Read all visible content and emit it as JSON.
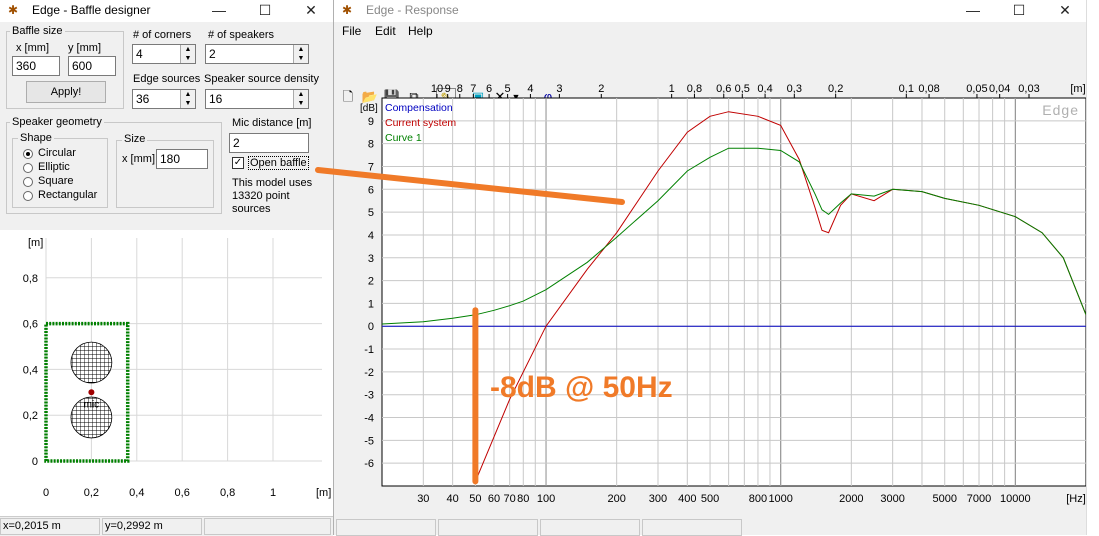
{
  "baffle_window": {
    "title": "Edge - Baffle designer",
    "title_buttons": [
      "—",
      "☐",
      "✕"
    ],
    "baffle_size": {
      "legend": "Baffle size",
      "x_label": "x [mm]",
      "y_label": "y [mm]",
      "x_value": "360",
      "y_value": "600",
      "apply_label": "Apply!"
    },
    "corners": {
      "label": "# of corners",
      "value": "4"
    },
    "speakers": {
      "label": "# of speakers",
      "value": "2"
    },
    "edge_sources": {
      "label": "Edge sources",
      "value": "36"
    },
    "source_density": {
      "label": "Speaker source density",
      "value": "16"
    },
    "speaker_geometry": {
      "legend": "Speaker geometry",
      "shape_legend": "Shape",
      "shapes": [
        "Circular",
        "Elliptic",
        "Square",
        "Rectangular"
      ],
      "selected_shape": "Circular",
      "size_legend": "Size",
      "size_label": "x [mm]",
      "size_value": "180"
    },
    "mic_distance": {
      "label": "Mic distance [m]",
      "value": "2"
    },
    "open_baffle": {
      "label": "Open baffle",
      "checked": true
    },
    "model_info": [
      "This model uses",
      "13320 point",
      "sources"
    ],
    "plot": {
      "y_unit": "[m]",
      "x_unit": "[m]",
      "y_ticks": [
        "0,8",
        "0,6",
        "0,4",
        "0,2",
        "0"
      ],
      "x_ticks": [
        "0",
        "0,2",
        "0,4",
        "0,6",
        "0,8",
        "1"
      ],
      "mic_label": "mic",
      "baffle_color": "#008000"
    },
    "status": {
      "x": "x=0,2015 m",
      "y": "y=0,2992 m"
    }
  },
  "response_window": {
    "title": "Edge - Response",
    "title_buttons": [
      "—",
      "☐",
      "✕"
    ],
    "menu": [
      "File",
      "Edit",
      "Help"
    ],
    "toolbar_icons": [
      "new-icon",
      "open-icon",
      "save-icon",
      "copy-icon",
      "pencil-icon",
      "scope-icon",
      "delete-icon",
      "dropdown-icon",
      "phase-icon"
    ],
    "phase_symbol": "φ",
    "watermark": "Edge",
    "annotation_text": "-8dB @ 50Hz",
    "annotation_color": "#f07a28"
  },
  "chart_data": {
    "type": "line",
    "xscale": "log",
    "xlabel": "[Hz]",
    "ylabel": "[dB]",
    "top_axis_label": "[m]",
    "xlim": [
      20,
      20000
    ],
    "ylim": [
      -7,
      10
    ],
    "x_ticks": [
      30,
      40,
      50,
      60,
      70,
      80,
      100,
      200,
      300,
      400,
      500,
      800,
      1000,
      2000,
      3000,
      5000,
      7000,
      10000
    ],
    "x_tick_labels": [
      "30",
      "40",
      "50",
      "60",
      "70",
      "80",
      "100",
      "200",
      "300",
      "400",
      "500",
      "800",
      "1000",
      "2000",
      "3000",
      "5000",
      "7000",
      "10000"
    ],
    "y_ticks": [
      9,
      8,
      7,
      6,
      5,
      4,
      3,
      2,
      1,
      0,
      -1,
      -2,
      -3,
      -4,
      -5,
      -6
    ],
    "top_ticks": [
      {
        "label": "10",
        "hz": 34.3
      },
      {
        "label": "9",
        "hz": 38.1
      },
      {
        "label": "8",
        "hz": 42.9
      },
      {
        "label": "7",
        "hz": 49.0
      },
      {
        "label": "6",
        "hz": 57.2
      },
      {
        "label": "5",
        "hz": 68.6
      },
      {
        "label": "4",
        "hz": 85.8
      },
      {
        "label": "3",
        "hz": 114
      },
      {
        "label": "2",
        "hz": 172
      },
      {
        "label": "1",
        "hz": 343
      },
      {
        "label": "0,8",
        "hz": 429
      },
      {
        "label": "0,6",
        "hz": 572
      },
      {
        "label": "0,5",
        "hz": 686
      },
      {
        "label": "0,4",
        "hz": 858
      },
      {
        "label": "0,3",
        "hz": 1143
      },
      {
        "label": "0,2",
        "hz": 1715
      },
      {
        "label": "0,1",
        "hz": 3430
      },
      {
        "label": "0,08",
        "hz": 4288
      },
      {
        "label": "0,05",
        "hz": 6860
      },
      {
        "label": "0,04",
        "hz": 8575
      },
      {
        "label": "0,03",
        "hz": 11433
      }
    ],
    "legend": [
      {
        "name": "Compensation",
        "color": "#0000c0"
      },
      {
        "name": "Current system",
        "color": "#c00000"
      },
      {
        "name": "Curve 1",
        "color": "#008000"
      }
    ],
    "series": [
      {
        "name": "Compensation",
        "color": "#0000c0",
        "x": [
          20,
          20000
        ],
        "y": [
          0,
          0
        ]
      },
      {
        "name": "Current system",
        "color": "#c00000",
        "x": [
          50,
          70,
          100,
          150,
          200,
          300,
          400,
          500,
          600,
          800,
          1000,
          1200,
          1400,
          1500,
          1600,
          1800,
          2000,
          2500,
          3000,
          4000,
          5000,
          7000,
          10000,
          13000,
          16000,
          20000
        ],
        "y": [
          -6.8,
          -3.2,
          0,
          2.5,
          4.1,
          6.8,
          8.5,
          9.2,
          9.4,
          9.2,
          8.8,
          7.3,
          5.2,
          4.2,
          4.1,
          5.3,
          5.8,
          5.5,
          6.0,
          5.9,
          5.6,
          5.3,
          4.8,
          4.1,
          3.0,
          0.5
        ]
      },
      {
        "name": "Curve 1",
        "color": "#008000",
        "x": [
          20,
          30,
          40,
          50,
          60,
          70,
          80,
          100,
          150,
          200,
          300,
          400,
          500,
          600,
          700,
          800,
          1000,
          1200,
          1400,
          1500,
          1600,
          1800,
          2000,
          2500,
          3000,
          4000,
          5000,
          7000,
          10000,
          13000,
          16000,
          20000
        ],
        "y": [
          0.1,
          0.2,
          0.35,
          0.5,
          0.7,
          0.9,
          1.1,
          1.6,
          2.8,
          3.9,
          5.5,
          6.8,
          7.4,
          7.8,
          7.8,
          7.8,
          7.7,
          7.2,
          5.8,
          5.1,
          4.9,
          5.4,
          5.8,
          5.7,
          6.0,
          5.9,
          5.6,
          5.3,
          4.8,
          4.1,
          3.0,
          0.5
        ]
      }
    ]
  }
}
